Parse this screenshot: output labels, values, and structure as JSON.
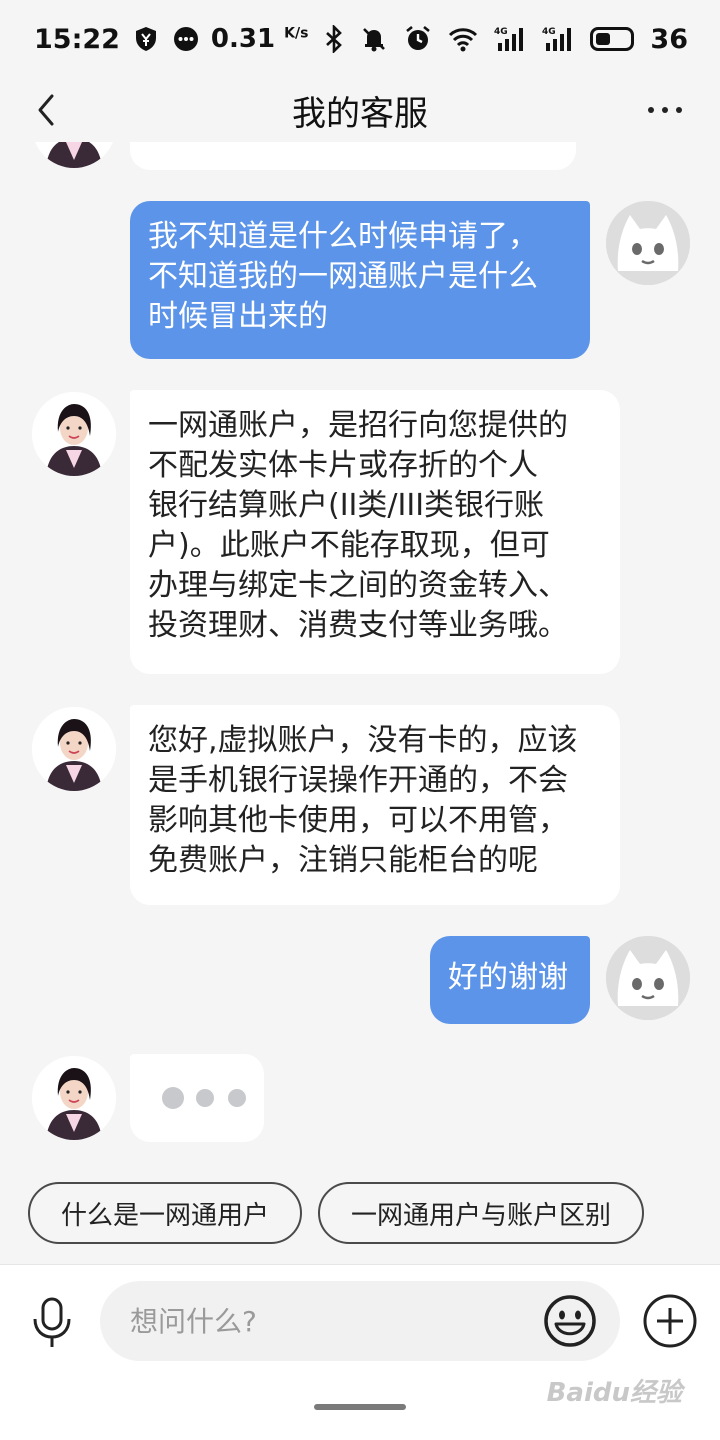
{
  "status_bar": {
    "time": "15:22",
    "net_speed": "0.31",
    "net_speed_unit": "K/s",
    "battery": "36",
    "signal_label_1": "4G",
    "signal_label_2": "4G"
  },
  "nav": {
    "title": "我的客服"
  },
  "messages": [
    {
      "from": "user",
      "lines": [
        "我不知道是什么时候申请了，",
        "不知道我的一网通账户是什么",
        "时候冒出来的"
      ]
    },
    {
      "from": "agent",
      "lines": [
        "一网通账户，是招行向您提供的",
        "不配发实体卡片或存折的个人",
        "银行结算账户(II类/III类银行账",
        "户)。此账户不能存取现，但可",
        "办理与绑定卡之间的资金转入、",
        "投资理财、消费支付等业务哦。"
      ]
    },
    {
      "from": "agent",
      "lines": [
        "您好,虚拟账户，没有卡的，应该",
        "是手机银行误操作开通的，不会",
        "影响其他卡使用，可以不用管，",
        "免费账户，注销只能柜台的呢"
      ]
    },
    {
      "from": "user",
      "lines": [
        "好的谢谢"
      ]
    }
  ],
  "quick_replies": [
    "什么是一网通用户",
    "一网通用户与账户区别"
  ],
  "input": {
    "placeholder": "想问什么?"
  },
  "watermark": "Baidu经验",
  "colors": {
    "user_bubble": "#5b94e8",
    "agent_bubble": "#ffffff",
    "background": "#f5f5f5"
  },
  "icons": {
    "back": "chevron-left-icon",
    "more": "more-dots-icon",
    "mic": "microphone-icon",
    "emoji": "smiley-icon",
    "plus": "plus-circle-icon"
  }
}
